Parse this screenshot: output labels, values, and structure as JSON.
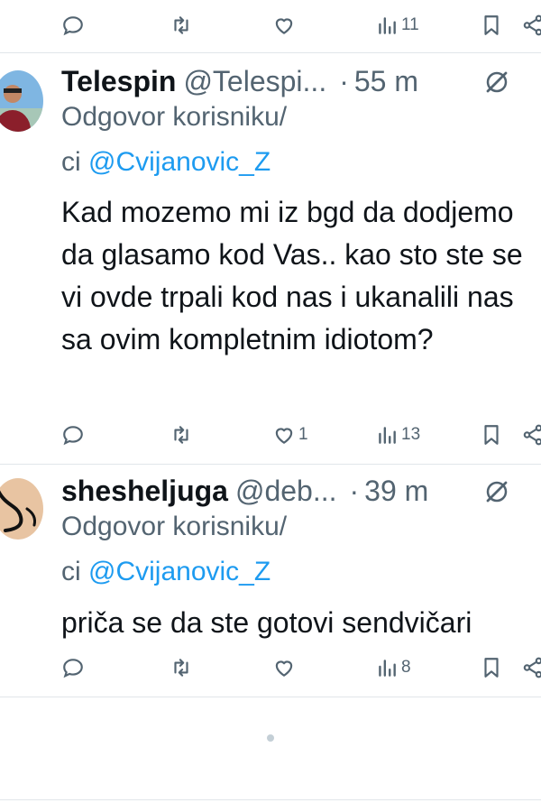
{
  "top_actions": {
    "views_count": "11"
  },
  "tweets": [
    {
      "display_name": "Telespin",
      "handle": "@Telespi...",
      "time": "55 m",
      "reply_prefix": "Odgovor korisniku/",
      "reply_ci": "ci",
      "reply_mention": "@Cvijanovic_Z",
      "text": "Kad mozemo mi iz bgd da dodjemo da glasamo kod Vas.. kao sto ste se vi ovde trpali kod nas i ukanalili nas sa ovim kompletnim idiotom?",
      "likes": "1",
      "views": "13"
    },
    {
      "display_name": "sheshelјuga",
      "handle": "@deb...",
      "time": "39 m",
      "reply_prefix": "Odgovor korisniku/",
      "reply_ci": "ci",
      "reply_mention": "@Cvijanovic_Z",
      "text": "priča se da ste gotovi sendvičari",
      "likes": "",
      "views": "8"
    }
  ],
  "icons": [
    "reply-icon",
    "retweet-icon",
    "like-icon",
    "views-icon",
    "bookmark-icon",
    "share-icon",
    "grok-icon"
  ],
  "colors": {
    "text": "#0f1419",
    "secondary": "#536471",
    "link": "#1d9bf0",
    "divider": "#e1e6ea"
  }
}
